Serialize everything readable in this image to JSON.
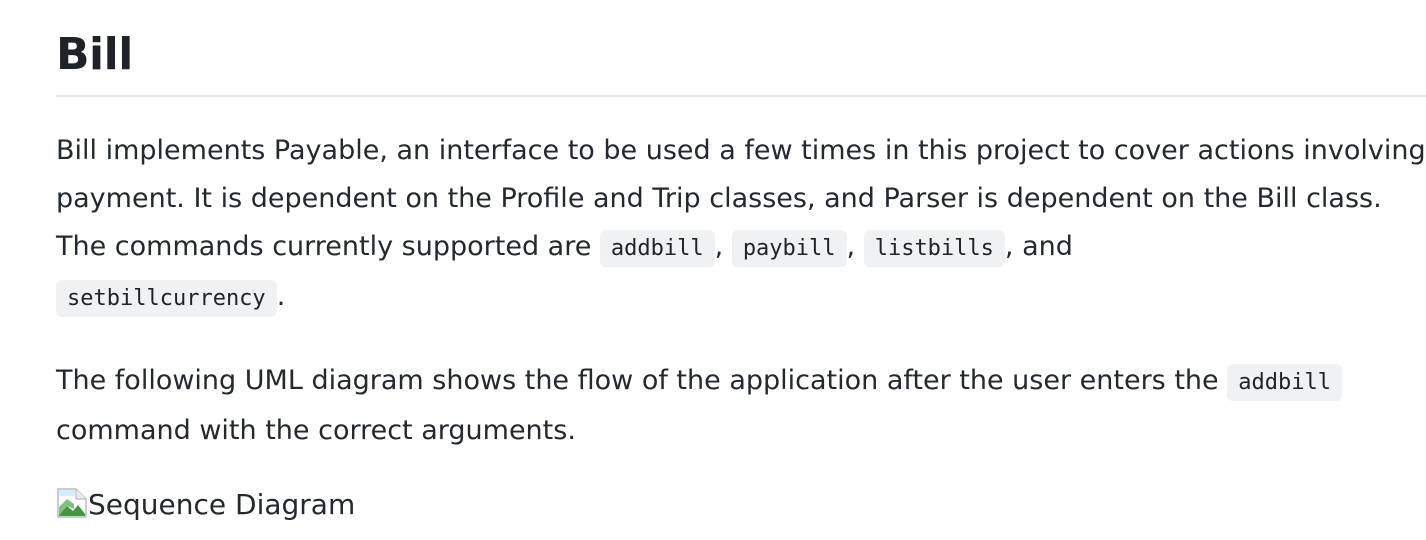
{
  "heading": "Bill",
  "paragraph1": {
    "text_before_codes": "Bill implements Payable, an interface to be used a few times in this project to cover actions involving payment. It is dependent on the Profile and Trip classes, and Parser is dependent on the Bill class. The commands currently supported are ",
    "code1": "addbill",
    "sep1": ", ",
    "code2": "paybill",
    "sep2": ", ",
    "code3": "listbills",
    "sep3": ", and ",
    "code4": "setbillcurrency",
    "end": "."
  },
  "paragraph2": {
    "text_before_code": "The following UML diagram shows the flow of the application after the user enters the ",
    "code": "addbill",
    "text_after_code": " command with the correct arguments."
  },
  "image": {
    "alt": "Sequence Diagram",
    "icon": "broken-image-icon"
  }
}
